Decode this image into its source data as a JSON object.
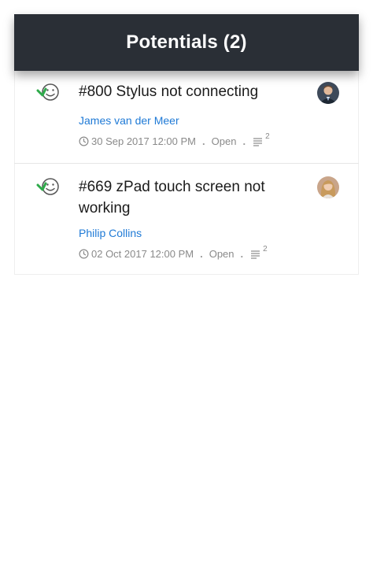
{
  "header": {
    "title": "Potentials (2)"
  },
  "colors": {
    "header_bg": "#2a2f36",
    "link": "#1f7ad6",
    "status_green": "#2eaa4a"
  },
  "potentials": [
    {
      "title": "#800 Stylus not connecting",
      "contact": "James van der Meer",
      "datetime": "30 Sep 2017 12:00 PM",
      "status": "Open",
      "sep": ".",
      "count": "2",
      "status_icon": "smiley-arrow-icon",
      "avatar": "avatar-man"
    },
    {
      "title": "#669 zPad touch screen not working",
      "contact": "Philip Collins",
      "datetime": "02 Oct 2017 12:00 PM",
      "status": "Open",
      "sep": ".",
      "count": "2",
      "status_icon": "smiley-arrow-icon",
      "avatar": "avatar-woman"
    }
  ]
}
